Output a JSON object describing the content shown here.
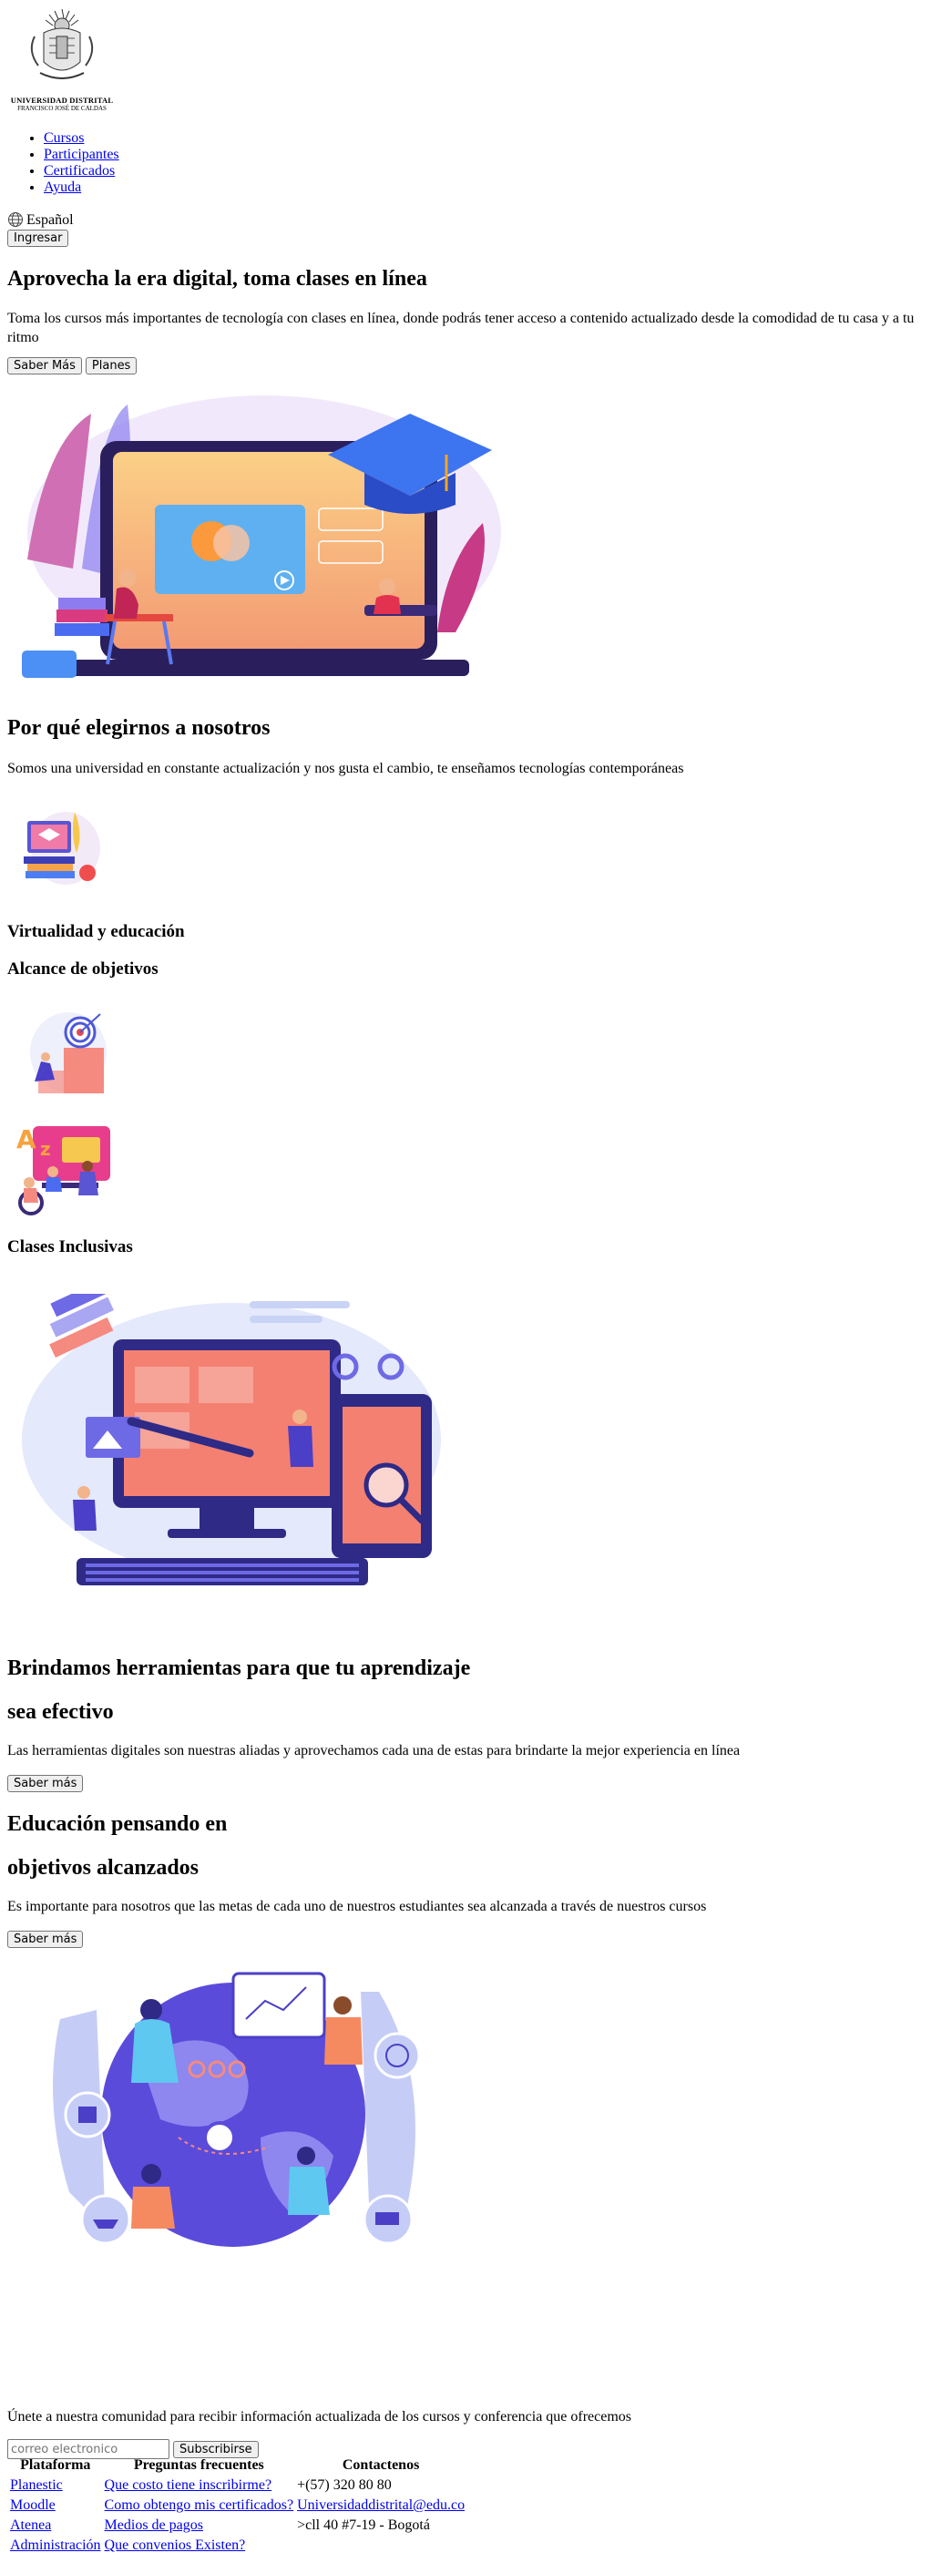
{
  "logo": {
    "line1": "UNIVERSIDAD DISTRITAL",
    "line2": "FRANCISCO JOSÉ DE CALDAS"
  },
  "nav": {
    "items": [
      {
        "label": "Cursos"
      },
      {
        "label": "Participantes"
      },
      {
        "label": "Certificados"
      },
      {
        "label": "Ayuda"
      }
    ],
    "language": "Español",
    "login_button": "Ingresar"
  },
  "hero": {
    "title": "Aprovecha la era digital, toma clases en línea",
    "description": "Toma los cursos más importantes de tecnología con clases en línea, donde podrás tener acceso a contenido actualizado desde la comodidad de tu casa y a tu ritmo",
    "btn_more": "Saber Más",
    "btn_plans": "Planes"
  },
  "why": {
    "title": "Por qué elegirnos a nosotros",
    "description": "Somos una universidad en constante actualización y nos gusta el cambio, te enseñamos tecnologías contemporáneas",
    "feature1": "Virtualidad y educación",
    "feature2": "Alcance de objetivos",
    "feature3": "Clases Inclusivas"
  },
  "tools": {
    "title_line1": "Brindamos herramientas para que tu aprendizaje",
    "title_line2": "sea efectivo",
    "description": "Las herramientas digitales son nuestras aliadas y aprovechamos cada una de estas para brindarte la mejor experiencia en línea",
    "button": "Saber más"
  },
  "goals": {
    "title_line1": "Educación pensando en",
    "title_line2": "objetivos alcanzados",
    "description": "Es importante para nosotros que las metas de cada uno de nuestros estudiantes sea alcanzada a través de nuestros cursos",
    "button": "Saber más"
  },
  "newsletter": {
    "text": "Únete a nuestra comunidad para recibir información actualizada de los cursos y conferencia que ofrecemos",
    "placeholder": "correo electronico",
    "button": "Subscribirse"
  },
  "footer": {
    "headers": [
      "Plataforma",
      "Preguntas frecuentes",
      "Contactenos"
    ],
    "platforms": [
      "Planestic",
      "Moodle",
      "Atenea",
      "Administración"
    ],
    "faq": [
      "Que costo tiene inscribirme?",
      "Como obtengo mis certificados?",
      "Medios de pagos",
      "Que convenios Existen?"
    ],
    "contact": [
      "+(57) 320 80 80",
      "Universidaddistrital@edu.co",
      ">cll 40 #7-19 - Bogotá"
    ]
  },
  "colors": {
    "link": "#0000ee",
    "visited_link": "#551a8b",
    "accent_purple": "#5b4bdb",
    "accent_coral": "#f5735d"
  }
}
